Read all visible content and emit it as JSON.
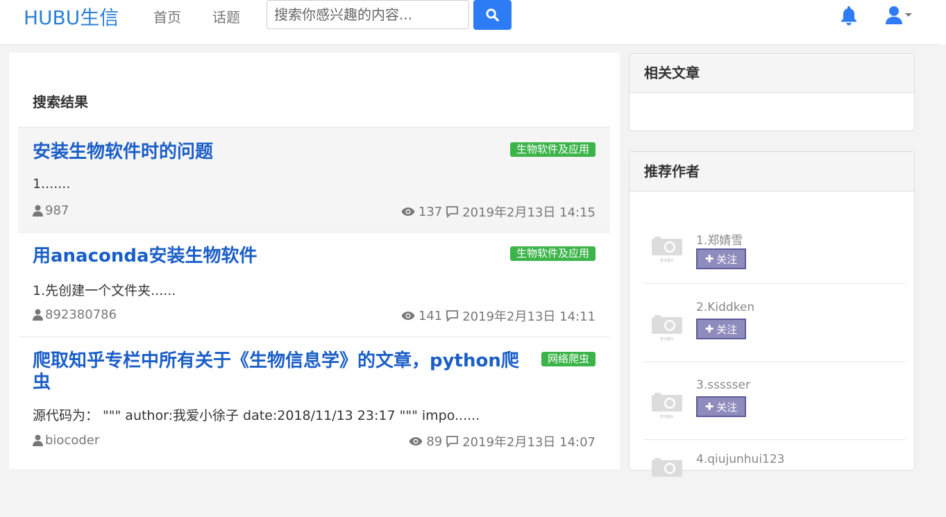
{
  "nav": {
    "brand": "HUBU生信",
    "links": [
      "首页",
      "话题"
    ],
    "search_placeholder": "搜索你感兴趣的内容..."
  },
  "main": {
    "results_title": "搜索结果",
    "articles": [
      {
        "title": "安装生物软件时的问题",
        "tag": "生物软件及应用",
        "excerpt": "1.......",
        "author": "987",
        "views": "137",
        "date": "2019年2月13日 14:15"
      },
      {
        "title": "用anaconda安装生物软件",
        "tag": "生物软件及应用",
        "excerpt": "1.先创建一个文件夹......",
        "author": "892380786",
        "views": "141",
        "date": "2019年2月13日 14:11"
      },
      {
        "title": "爬取知乎专栏中所有关于《生物信息学》的文章，python爬虫",
        "tag": "网络爬虫",
        "excerpt": "源代码为：  \"\"\" author:我爱小徐子 date:2018/11/13 23:17 \"\"\" impo......",
        "author": "biocoder",
        "views": "89",
        "date": "2019年2月13日 14:07"
      }
    ]
  },
  "sidebar": {
    "related_title": "相关文章",
    "recommend_title": "推荐作者",
    "avatar_placeholder_text": "暂无图片",
    "follow_label": "关注",
    "authors": [
      "1.郑婧雪",
      "2.Kiddken",
      "3.ssssser",
      "4.qiujunhui123"
    ]
  },
  "colors": {
    "brand": "#2a7fd7",
    "link": "#1a5ec7",
    "tag": "#3cb44a",
    "search_button": "#2d7cf6",
    "follow_button": "#8e8bbd"
  }
}
